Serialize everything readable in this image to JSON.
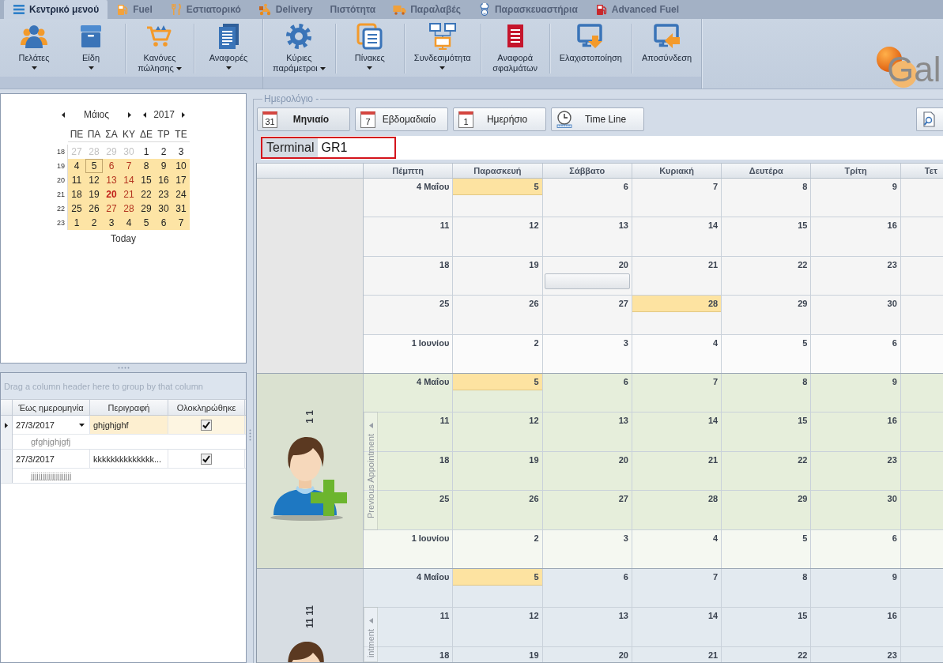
{
  "tabs": [
    {
      "label": "Κεντρικό μενού",
      "selected": true
    },
    {
      "label": "Fuel",
      "selected": false
    },
    {
      "label": "Εστιατορικό",
      "selected": false
    },
    {
      "label": "Delivery",
      "selected": false
    },
    {
      "label": "Πιστότητα",
      "selected": false
    },
    {
      "label": "Παραλαβές",
      "selected": false
    },
    {
      "label": "Παρασκευαστήρια",
      "selected": false
    },
    {
      "label": "Advanced Fuel",
      "selected": false
    }
  ],
  "ribbon": {
    "groups": [
      {
        "sections": [
          {
            "items": [
              {
                "label": "Πελάτες",
                "dropdown": true
              },
              {
                "label": "Είδη",
                "dropdown": true
              }
            ]
          },
          {
            "items": [
              {
                "label": "Κανόνες πώλησης",
                "dropdown": true
              }
            ]
          },
          {
            "items": [
              {
                "label": "Αναφορές",
                "dropdown": true
              }
            ]
          }
        ]
      },
      {
        "sections": [
          {
            "items": [
              {
                "label": "Κύριες παράμετροι",
                "dropdown": true
              }
            ]
          },
          {
            "items": [
              {
                "label": "Πίνακες",
                "dropdown": true
              }
            ]
          },
          {
            "items": [
              {
                "label": "Συνδεσιμότητα",
                "dropdown": true
              }
            ]
          },
          {
            "items": [
              {
                "label": "Αναφορά σφαλμάτων",
                "dropdown": false
              }
            ]
          },
          {
            "items": [
              {
                "label": "Ελαχιστοποίηση",
                "dropdown": false
              }
            ]
          },
          {
            "items": [
              {
                "label": "Αποσύνδεση",
                "dropdown": false
              }
            ]
          }
        ]
      }
    ],
    "logo": {
      "text": "Gal"
    }
  },
  "mini_calendar": {
    "month": "Μάιος",
    "year": "2017",
    "weekdays": [
      "ΠΕ",
      "ΠΑ",
      "ΣΑ",
      "ΚΥ",
      "ΔΕ",
      "ΤΡ",
      "ΤΕ"
    ],
    "weeks": [
      {
        "number": "18",
        "in_range": false,
        "days": [
          {
            "d": "27",
            "kind": "other"
          },
          {
            "d": "28",
            "kind": "other"
          },
          {
            "d": "29",
            "kind": "other"
          },
          {
            "d": "30",
            "kind": "other"
          },
          {
            "d": "1",
            "kind": "plain"
          },
          {
            "d": "2",
            "kind": "plain"
          },
          {
            "d": "3",
            "kind": "plain"
          }
        ]
      },
      {
        "number": "19",
        "in_range": true,
        "days": [
          {
            "d": "4",
            "kind": "plain"
          },
          {
            "d": "5",
            "kind": "today"
          },
          {
            "d": "6",
            "kind": "weekend"
          },
          {
            "d": "7",
            "kind": "weekend"
          },
          {
            "d": "8",
            "kind": "plain"
          },
          {
            "d": "9",
            "kind": "plain"
          },
          {
            "d": "10",
            "kind": "plain"
          }
        ]
      },
      {
        "number": "20",
        "in_range": true,
        "days": [
          {
            "d": "11",
            "kind": "plain"
          },
          {
            "d": "12",
            "kind": "plain"
          },
          {
            "d": "13",
            "kind": "weekend"
          },
          {
            "d": "14",
            "kind": "weekend"
          },
          {
            "d": "15",
            "kind": "plain"
          },
          {
            "d": "16",
            "kind": "plain"
          },
          {
            "d": "17",
            "kind": "plain"
          }
        ]
      },
      {
        "number": "21",
        "in_range": true,
        "days": [
          {
            "d": "18",
            "kind": "plain"
          },
          {
            "d": "19",
            "kind": "plain"
          },
          {
            "d": "20",
            "kind": "marked"
          },
          {
            "d": "21",
            "kind": "weekend"
          },
          {
            "d": "22",
            "kind": "plain"
          },
          {
            "d": "23",
            "kind": "plain"
          },
          {
            "d": "24",
            "kind": "plain"
          }
        ]
      },
      {
        "number": "22",
        "in_range": true,
        "days": [
          {
            "d": "25",
            "kind": "plain"
          },
          {
            "d": "26",
            "kind": "plain"
          },
          {
            "d": "27",
            "kind": "weekend"
          },
          {
            "d": "28",
            "kind": "weekend"
          },
          {
            "d": "29",
            "kind": "plain"
          },
          {
            "d": "30",
            "kind": "plain"
          },
          {
            "d": "31",
            "kind": "plain"
          }
        ]
      },
      {
        "number": "23",
        "in_range": true,
        "days": [
          {
            "d": "1",
            "kind": "plain"
          },
          {
            "d": "2",
            "kind": "plain"
          },
          {
            "d": "3",
            "kind": "plain"
          },
          {
            "d": "4",
            "kind": "plain"
          },
          {
            "d": "5",
            "kind": "plain"
          },
          {
            "d": "6",
            "kind": "plain"
          },
          {
            "d": "7",
            "kind": "plain"
          }
        ]
      }
    ],
    "today_button": "Today"
  },
  "task_grid": {
    "group_panel": "Drag a column header here to group by that column",
    "columns": [
      "Έως ημερομηνία",
      "Περιγραφή",
      "Ολοκληρώθηκε"
    ],
    "rows": [
      {
        "selected": true,
        "date": "27/3/2017",
        "description": "ghjghjghf",
        "completed": true,
        "preview": "gfghjghjgfj"
      },
      {
        "selected": false,
        "date": "27/3/2017",
        "description": "kkkkkkkkkkkkkk...",
        "completed": true,
        "preview": "jjjjjjjjjjjjjjjjjjjjj"
      }
    ]
  },
  "scheduler": {
    "title": "Ημερολόγιο -",
    "views": [
      {
        "label": "Μηνιαίο",
        "kind": "calendar",
        "icon_text": "31",
        "selected": true
      },
      {
        "label": "Εβδομαδιαίο",
        "kind": "calendar",
        "icon_text": "7",
        "selected": false
      },
      {
        "label": "Ημερήσιο",
        "kind": "calendar",
        "icon_text": "1",
        "selected": false
      },
      {
        "label": "Time Line",
        "kind": "timeline",
        "selected": false
      }
    ],
    "filter": {
      "label": "Terminal",
      "value": "GR1"
    },
    "columns": [
      "Πέμπτη",
      "Παρασκευή",
      "Σάββατο",
      "Κυριακή",
      "Δευτέρα",
      "Τρίτη",
      "Τετ"
    ],
    "resources": [
      {
        "kind": "blank",
        "color": "#f5f5f5",
        "weeks": [
          {
            "next_month": false,
            "cells": [
              {
                "date": "4 Μαΐου",
                "highlighted": false,
                "appointment": false
              },
              {
                "date": "5",
                "highlighted": true,
                "appointment": false
              },
              {
                "date": "6",
                "highlighted": false,
                "appointment": false
              },
              {
                "date": "7",
                "highlighted": false,
                "appointment": false
              },
              {
                "date": "8",
                "highlighted": false,
                "appointment": false
              },
              {
                "date": "9",
                "highlighted": false,
                "appointment": false
              }
            ]
          },
          {
            "next_month": false,
            "cells": [
              {
                "date": "11",
                "highlighted": false,
                "appointment": false
              },
              {
                "date": "12",
                "highlighted": false,
                "appointment": false
              },
              {
                "date": "13",
                "highlighted": false,
                "appointment": false
              },
              {
                "date": "14",
                "highlighted": false,
                "appointment": false
              },
              {
                "date": "15",
                "highlighted": false,
                "appointment": false
              },
              {
                "date": "16",
                "highlighted": false,
                "appointment": false
              }
            ]
          },
          {
            "next_month": false,
            "cells": [
              {
                "date": "18",
                "highlighted": false,
                "appointment": false
              },
              {
                "date": "19",
                "highlighted": false,
                "appointment": false
              },
              {
                "date": "20",
                "highlighted": false,
                "appointment": true
              },
              {
                "date": "21",
                "highlighted": false,
                "appointment": false
              },
              {
                "date": "22",
                "highlighted": false,
                "appointment": false
              },
              {
                "date": "23",
                "highlighted": false,
                "appointment": false
              }
            ]
          },
          {
            "next_month": false,
            "cells": [
              {
                "date": "25",
                "highlighted": false,
                "appointment": false
              },
              {
                "date": "26",
                "highlighted": false,
                "appointment": false
              },
              {
                "date": "27",
                "highlighted": false,
                "appointment": false
              },
              {
                "date": "28",
                "highlighted": true,
                "appointment": false
              },
              {
                "date": "29",
                "highlighted": false,
                "appointment": false
              },
              {
                "date": "30",
                "highlighted": false,
                "appointment": false
              }
            ]
          },
          {
            "next_month": true,
            "cells": [
              {
                "date": "1 Ιουνίου",
                "highlighted": false,
                "appointment": false
              },
              {
                "date": "2",
                "highlighted": false,
                "appointment": false
              },
              {
                "date": "3",
                "highlighted": false,
                "appointment": false
              },
              {
                "date": "4",
                "highlighted": false,
                "appointment": false
              },
              {
                "date": "5",
                "highlighted": false,
                "appointment": false
              },
              {
                "date": "6",
                "highlighted": false,
                "appointment": false
              }
            ]
          }
        ]
      },
      {
        "kind": "person",
        "name": "1 1",
        "color": "#e6eedb",
        "nav_label": "Previous Appointment",
        "weeks": [
          {
            "next_month": false,
            "cells": [
              {
                "date": "4 Μαΐου",
                "highlighted": false,
                "appointment": false
              },
              {
                "date": "5",
                "highlighted": true,
                "appointment": false
              },
              {
                "date": "6",
                "highlighted": false,
                "appointment": false
              },
              {
                "date": "7",
                "highlighted": false,
                "appointment": false
              },
              {
                "date": "8",
                "highlighted": false,
                "appointment": false
              },
              {
                "date": "9",
                "highlighted": false,
                "appointment": false
              }
            ]
          },
          {
            "next_month": false,
            "cells": [
              {
                "date": "11",
                "highlighted": false,
                "appointment": false
              },
              {
                "date": "12",
                "highlighted": false,
                "appointment": false
              },
              {
                "date": "13",
                "highlighted": false,
                "appointment": false
              },
              {
                "date": "14",
                "highlighted": false,
                "appointment": false
              },
              {
                "date": "15",
                "highlighted": false,
                "appointment": false
              },
              {
                "date": "16",
                "highlighted": false,
                "appointment": false
              }
            ]
          },
          {
            "next_month": false,
            "cells": [
              {
                "date": "18",
                "highlighted": false,
                "appointment": false
              },
              {
                "date": "19",
                "highlighted": false,
                "appointment": false
              },
              {
                "date": "20",
                "highlighted": false,
                "appointment": false
              },
              {
                "date": "21",
                "highlighted": false,
                "appointment": false
              },
              {
                "date": "22",
                "highlighted": false,
                "appointment": false
              },
              {
                "date": "23",
                "highlighted": false,
                "appointment": false
              }
            ]
          },
          {
            "next_month": false,
            "cells": [
              {
                "date": "25",
                "highlighted": false,
                "appointment": false
              },
              {
                "date": "26",
                "highlighted": false,
                "appointment": false
              },
              {
                "date": "27",
                "highlighted": false,
                "appointment": false
              },
              {
                "date": "28",
                "highlighted": false,
                "appointment": false
              },
              {
                "date": "29",
                "highlighted": false,
                "appointment": false
              },
              {
                "date": "30",
                "highlighted": false,
                "appointment": false
              }
            ]
          },
          {
            "next_month": true,
            "cells": [
              {
                "date": "1 Ιουνίου",
                "highlighted": false,
                "appointment": false
              },
              {
                "date": "2",
                "highlighted": false,
                "appointment": false
              },
              {
                "date": "3",
                "highlighted": false,
                "appointment": false
              },
              {
                "date": "4",
                "highlighted": false,
                "appointment": false
              },
              {
                "date": "5",
                "highlighted": false,
                "appointment": false
              },
              {
                "date": "6",
                "highlighted": false,
                "appointment": false
              }
            ]
          }
        ]
      },
      {
        "kind": "person",
        "name": "11 11",
        "color": "#e3eaf0",
        "nav_label": "intment",
        "weeks": [
          {
            "next_month": false,
            "cells": [
              {
                "date": "4 Μαΐου",
                "highlighted": false,
                "appointment": false
              },
              {
                "date": "5",
                "highlighted": true,
                "appointment": false
              },
              {
                "date": "6",
                "highlighted": false,
                "appointment": false
              },
              {
                "date": "7",
                "highlighted": false,
                "appointment": false
              },
              {
                "date": "8",
                "highlighted": false,
                "appointment": false
              },
              {
                "date": "9",
                "highlighted": false,
                "appointment": false
              }
            ]
          },
          {
            "next_month": false,
            "cells": [
              {
                "date": "11",
                "highlighted": false,
                "appointment": false
              },
              {
                "date": "12",
                "highlighted": false,
                "appointment": false
              },
              {
                "date": "13",
                "highlighted": false,
                "appointment": false
              },
              {
                "date": "14",
                "highlighted": false,
                "appointment": false
              },
              {
                "date": "15",
                "highlighted": false,
                "appointment": false
              },
              {
                "date": "16",
                "highlighted": false,
                "appointment": false
              }
            ]
          },
          {
            "next_month": false,
            "cells": [
              {
                "date": "18",
                "highlighted": false,
                "appointment": false
              },
              {
                "date": "19",
                "highlighted": false,
                "appointment": false
              },
              {
                "date": "20",
                "highlighted": false,
                "appointment": false
              },
              {
                "date": "21",
                "highlighted": false,
                "appointment": false
              },
              {
                "date": "22",
                "highlighted": false,
                "appointment": false
              },
              {
                "date": "23",
                "highlighted": false,
                "appointment": false
              }
            ]
          }
        ]
      }
    ]
  }
}
